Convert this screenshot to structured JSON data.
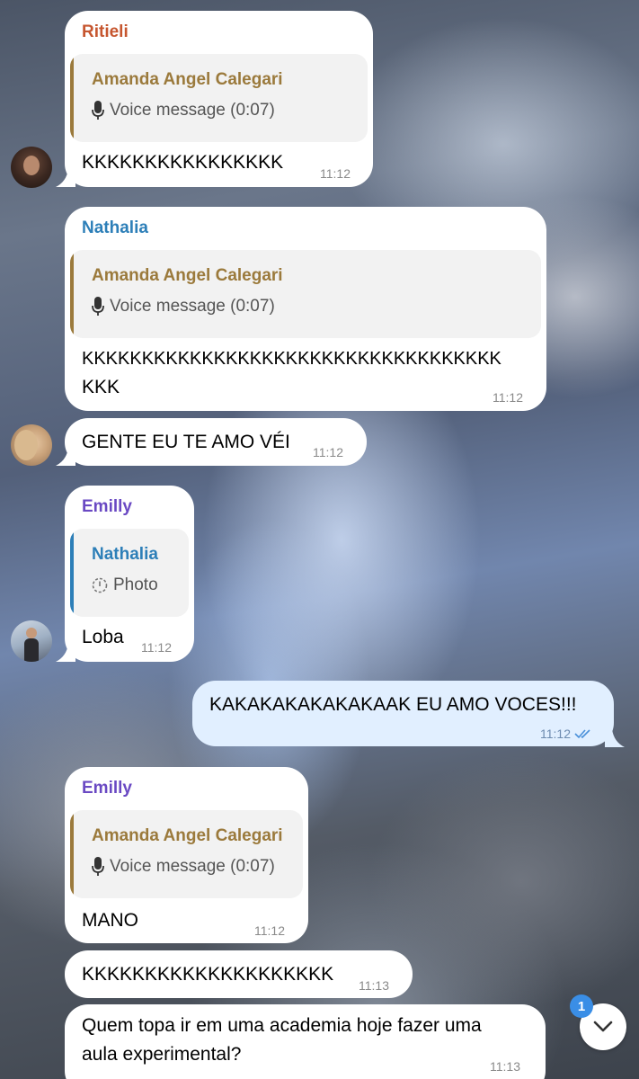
{
  "colors": {
    "ritieli": "#c6562f",
    "nathalia": "#2d7fb8",
    "emilly": "#6a49c3",
    "amanda": "#9b7a3c",
    "nathalia_reply": "#2d7fb8",
    "read_check": "#4a90d9",
    "badge": "#3a8ee6"
  },
  "messages": [
    {
      "sender": "Ritieli",
      "reply": {
        "name": "Amanda Angel Calegari",
        "detail": "Voice message (0:07)",
        "icon": "microphone-icon"
      },
      "text": "KKKKKKKKKKKKKKKK",
      "time": "11:12"
    },
    {
      "sender": "Nathalia",
      "reply": {
        "name": "Amanda Angel Calegari",
        "detail": "Voice message (0:07)",
        "icon": "microphone-icon"
      },
      "text_line1": "KKKKKKKKKKKKKKKKKKKKKKKKKKKKKKKKKKK",
      "text_line2": "KKK",
      "time": "11:12"
    },
    {
      "text": "GENTE EU TE AMO VÉI",
      "time": "11:12"
    },
    {
      "sender": "Emilly",
      "reply": {
        "name": "Nathalia",
        "detail": "Photo",
        "icon": "photo-timer-icon"
      },
      "text": "Loba",
      "time": "11:12"
    },
    {
      "text": "KAKAKAKAKAKAKAAK EU AMO VOCES!!!",
      "time": "11:12",
      "status": "read-double-check-icon"
    },
    {
      "sender": "Emilly",
      "reply": {
        "name": "Amanda Angel Calegari",
        "detail": "Voice message (0:07)",
        "icon": "microphone-icon"
      },
      "text": "MANO",
      "time": "11:12"
    },
    {
      "text": "KKKKKKKKKKKKKKKKKKKK",
      "time": "11:13"
    },
    {
      "text_line1": "Quem topa ir em uma academia hoje fazer uma",
      "text_line2": "aula experimental?",
      "time": "11:13"
    }
  ],
  "scroll_button": {
    "icon": "chevron-down-icon",
    "unread_count": "1"
  }
}
